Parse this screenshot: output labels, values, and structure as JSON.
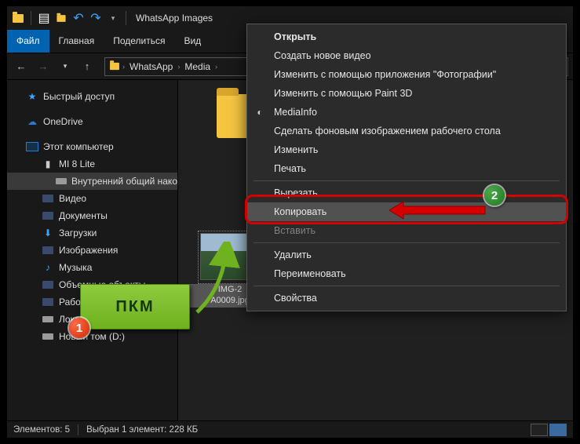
{
  "titlebar": {
    "title": "WhatsApp Images"
  },
  "ribbon": {
    "file": "Файл",
    "home": "Главная",
    "share": "Поделиться",
    "view": "Вид"
  },
  "breadcrumb": {
    "seg1": "WhatsApp",
    "seg2": "Media"
  },
  "sidebar": {
    "quick": "Быстрый доступ",
    "onedrive": "OneDrive",
    "thispc": "Этот компьютер",
    "mi8": "MI 8 Lite",
    "internal": "Внутренний общий накоп",
    "video": "Видео",
    "docs": "Документы",
    "downloads": "Загрузки",
    "images": "Изображения",
    "music": "Музыка",
    "objects": "Объемные объекты",
    "desktop": "Рабочий стол",
    "cdrive": "Локальный диск (C:)",
    "ddrive": "Новый том (D:)"
  },
  "files": {
    "selected_label_l1": "IMG-2",
    "selected_label_l2": "A0009.jpg"
  },
  "context_menu": {
    "open": "Открыть",
    "newvideo": "Создать новое видео",
    "editphotos": "Изменить с помощью приложения \"Фотографии\"",
    "paint3d": "Изменить с помощью Paint 3D",
    "mediainfo": "MediaInfo",
    "wallpaper": "Сделать фоновым изображением рабочего стола",
    "edit": "Изменить",
    "print": "Печать",
    "cut": "Вырезать",
    "copy": "Копировать",
    "paste": "Вставить",
    "delete": "Удалить",
    "rename": "Переименовать",
    "properties": "Свойства"
  },
  "annotations": {
    "rmb": "ПКМ",
    "step1": "1",
    "step2": "2"
  },
  "status": {
    "count": "Элементов: 5",
    "selected": "Выбран 1 элемент: 228 КБ"
  }
}
